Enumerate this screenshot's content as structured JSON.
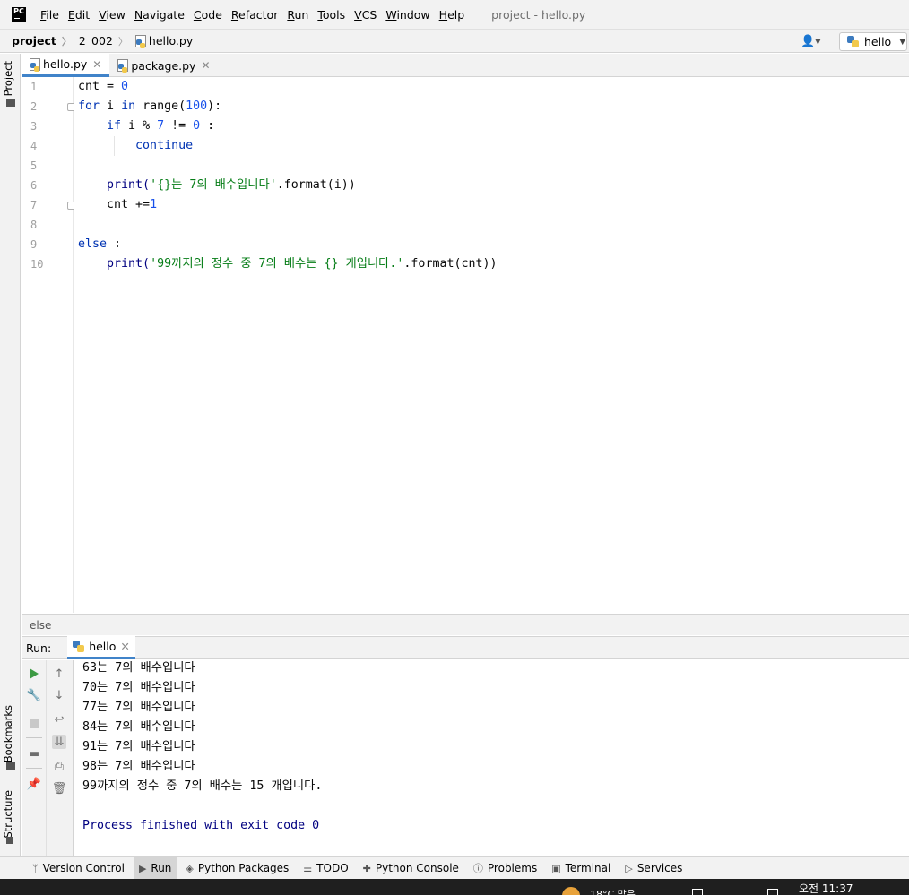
{
  "app": {
    "logo_text": "PC",
    "window_title": "project - hello.py",
    "menu": [
      "File",
      "Edit",
      "View",
      "Navigate",
      "Code",
      "Refactor",
      "Run",
      "Tools",
      "VCS",
      "Window",
      "Help"
    ]
  },
  "navbar": {
    "crumbs": [
      "project",
      "2_002",
      "hello.py"
    ],
    "run_config": "hello"
  },
  "left_strip": {
    "top_tab": "Project",
    "bookmarks_tab": "Bookmarks",
    "structure_tab": "Structure"
  },
  "editor": {
    "tabs": [
      {
        "label": "hello.py",
        "active": true
      },
      {
        "label": "package.py",
        "active": false
      }
    ],
    "line_numbers": [
      "1",
      "2",
      "3",
      "4",
      "5",
      "6",
      "7",
      "8",
      "9",
      "10"
    ],
    "lines": [
      [
        {
          "t": "cnt = ",
          "c": ""
        },
        {
          "t": "0",
          "c": "num"
        }
      ],
      [
        {
          "t": "for",
          "c": "kw"
        },
        {
          "t": " i ",
          "c": ""
        },
        {
          "t": "in",
          "c": "kw"
        },
        {
          "t": " range(",
          "c": ""
        },
        {
          "t": "100",
          "c": "num"
        },
        {
          "t": "):",
          "c": ""
        }
      ],
      [
        {
          "t": "    ",
          "c": ""
        },
        {
          "t": "if",
          "c": "kw"
        },
        {
          "t": " i % ",
          "c": ""
        },
        {
          "t": "7",
          "c": "num"
        },
        {
          "t": " != ",
          "c": ""
        },
        {
          "t": "0",
          "c": "num"
        },
        {
          "t": " :",
          "c": ""
        }
      ],
      [
        {
          "t": "        ",
          "c": ""
        },
        {
          "t": "continue",
          "c": "kw"
        }
      ],
      [],
      [
        {
          "t": "    ",
          "c": ""
        },
        {
          "t": "print(",
          "c": "call"
        },
        {
          "t": "'{}는 7의 배수입니다'",
          "c": "str"
        },
        {
          "t": ".format(i))",
          "c": ""
        }
      ],
      [
        {
          "t": "    cnt +=",
          "c": ""
        },
        {
          "t": "1",
          "c": "num"
        }
      ],
      [],
      [
        {
          "t": "else",
          "c": "kw"
        },
        {
          "t": " :",
          "c": ""
        }
      ],
      [
        {
          "t": "    ",
          "c": ""
        },
        {
          "t": "print(",
          "c": "call"
        },
        {
          "t": "'99까지의 정수 중 7의 배수는 {} 개입니다.'",
          "c": "str"
        },
        {
          "t": ".format(cnt))",
          "c": ""
        }
      ]
    ],
    "breadcrumb": "else"
  },
  "run_panel": {
    "label": "Run:",
    "tab": "hello",
    "output": [
      "63는 7의 배수입니다",
      "70는 7의 배수입니다",
      "77는 7의 배수입니다",
      "84는 7의 배수입니다",
      "91는 7의 배수입니다",
      "98는 7의 배수입니다",
      "99까지의 정수 중 7의 배수는 15 개입니다.",
      "",
      "Process finished with exit code 0"
    ]
  },
  "bottom_bar": {
    "tabs": [
      {
        "label": "Version Control",
        "icon": "branch-icon"
      },
      {
        "label": "Run",
        "icon": "run-icon",
        "active": true
      },
      {
        "label": "Python Packages",
        "icon": "layers-icon"
      },
      {
        "label": "TODO",
        "icon": "list-icon"
      },
      {
        "label": "Python Console",
        "icon": "python-icon"
      },
      {
        "label": "Problems",
        "icon": "info-icon"
      },
      {
        "label": "Terminal",
        "icon": "terminal-icon"
      },
      {
        "label": "Services",
        "icon": "services-icon"
      }
    ]
  },
  "taskbar": {
    "time": "오전 11:37",
    "weather": "18°C 맑음"
  },
  "colors": {
    "keyword": "#0033b3",
    "number": "#1750eb",
    "string": "#067d17",
    "accent": "#4083c9",
    "current_line": "#fcfaed"
  }
}
